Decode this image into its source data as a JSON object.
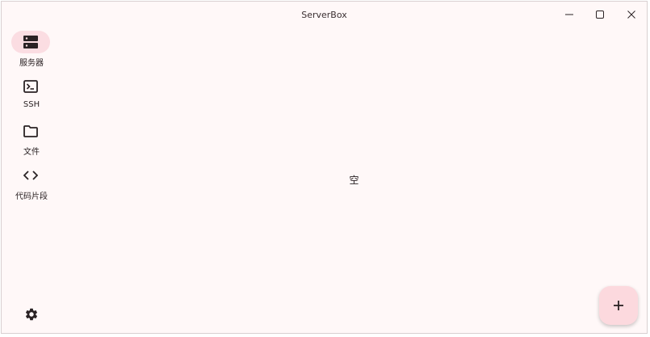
{
  "window": {
    "title": "ServerBox"
  },
  "nav": {
    "items": [
      {
        "label": "服务器",
        "icon": "server-icon",
        "active": true
      },
      {
        "label": "SSH",
        "icon": "terminal-icon",
        "active": false
      },
      {
        "label": "文件",
        "icon": "folder-icon",
        "active": false
      },
      {
        "label": "代码片段",
        "icon": "code-icon",
        "active": false
      }
    ],
    "settings_icon": "gear-icon"
  },
  "main": {
    "empty_text": "空"
  },
  "fab": {
    "icon": "plus-icon"
  },
  "colors": {
    "background": "#fff8f8",
    "active_indicator": "#fbdde2",
    "fab_background": "#fcd9de",
    "icon": "#2a2224"
  }
}
